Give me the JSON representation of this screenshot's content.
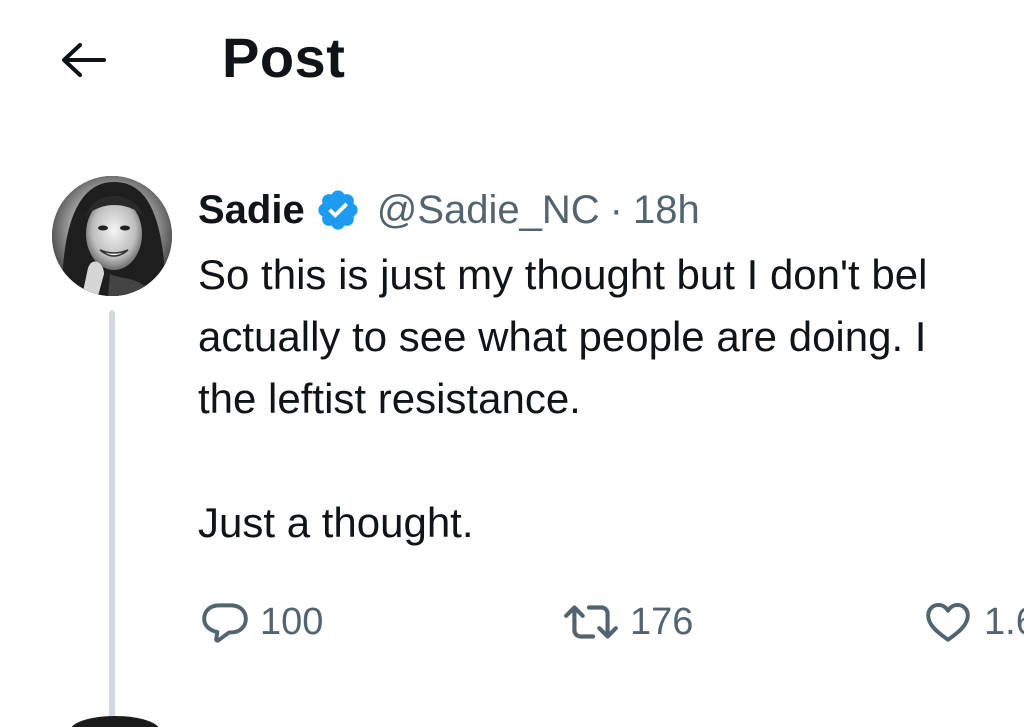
{
  "header": {
    "back_icon": "arrow-left-icon",
    "title": "Post"
  },
  "post": {
    "author_name": "Sadie",
    "verified_icon": "verified-badge-icon",
    "verified_color": "#1d9bf0",
    "handle": "@Sadie_NC",
    "separator": "·",
    "time": "18h",
    "body_lines": [
      "So this is just my thought but I don't bel",
      "actually to see what people are doing. I",
      "the leftist resistance.",
      "",
      "Just a thought."
    ],
    "actions": {
      "reply": {
        "icon": "reply-bubble-icon",
        "count": "100"
      },
      "repost": {
        "icon": "repost-icon",
        "count": "176"
      },
      "like": {
        "icon": "heart-icon",
        "count": "1.6"
      }
    }
  },
  "colors": {
    "text_primary": "#0f1419",
    "text_secondary": "#536471",
    "thread_line": "#cfd9de"
  }
}
